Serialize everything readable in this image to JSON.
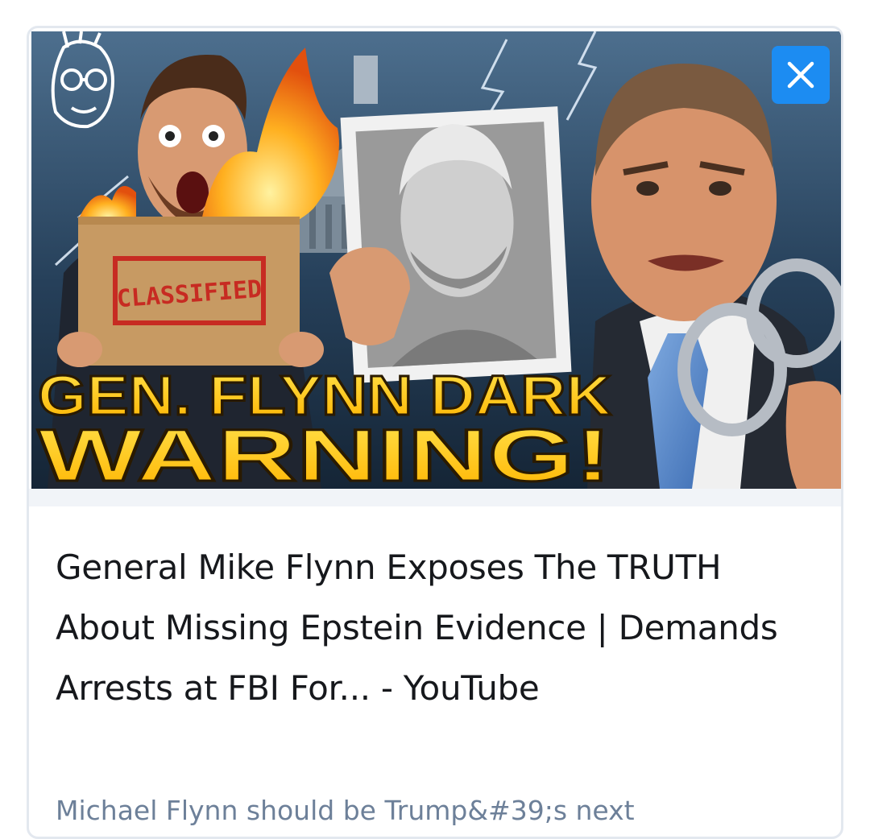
{
  "link_card": {
    "thumbnail": {
      "box_label": "CLASSIFIED",
      "headline_line1": "GEN. FLYNN DARK",
      "headline_line2": "WARNING!"
    },
    "close_icon": "close-icon",
    "title": "General Mike Flynn Exposes The TRUTH About Missing Epstein Evidence | Demands Arrests at FBI For... - YouTube",
    "description": "Michael Flynn should be Trump&#39;s next",
    "colors": {
      "close_button": "#1c8cf2",
      "headline_yellow": "#ffd21f",
      "classified_red": "#c72b22",
      "description_text": "#6d8099",
      "card_border": "#e3e8ef"
    }
  }
}
